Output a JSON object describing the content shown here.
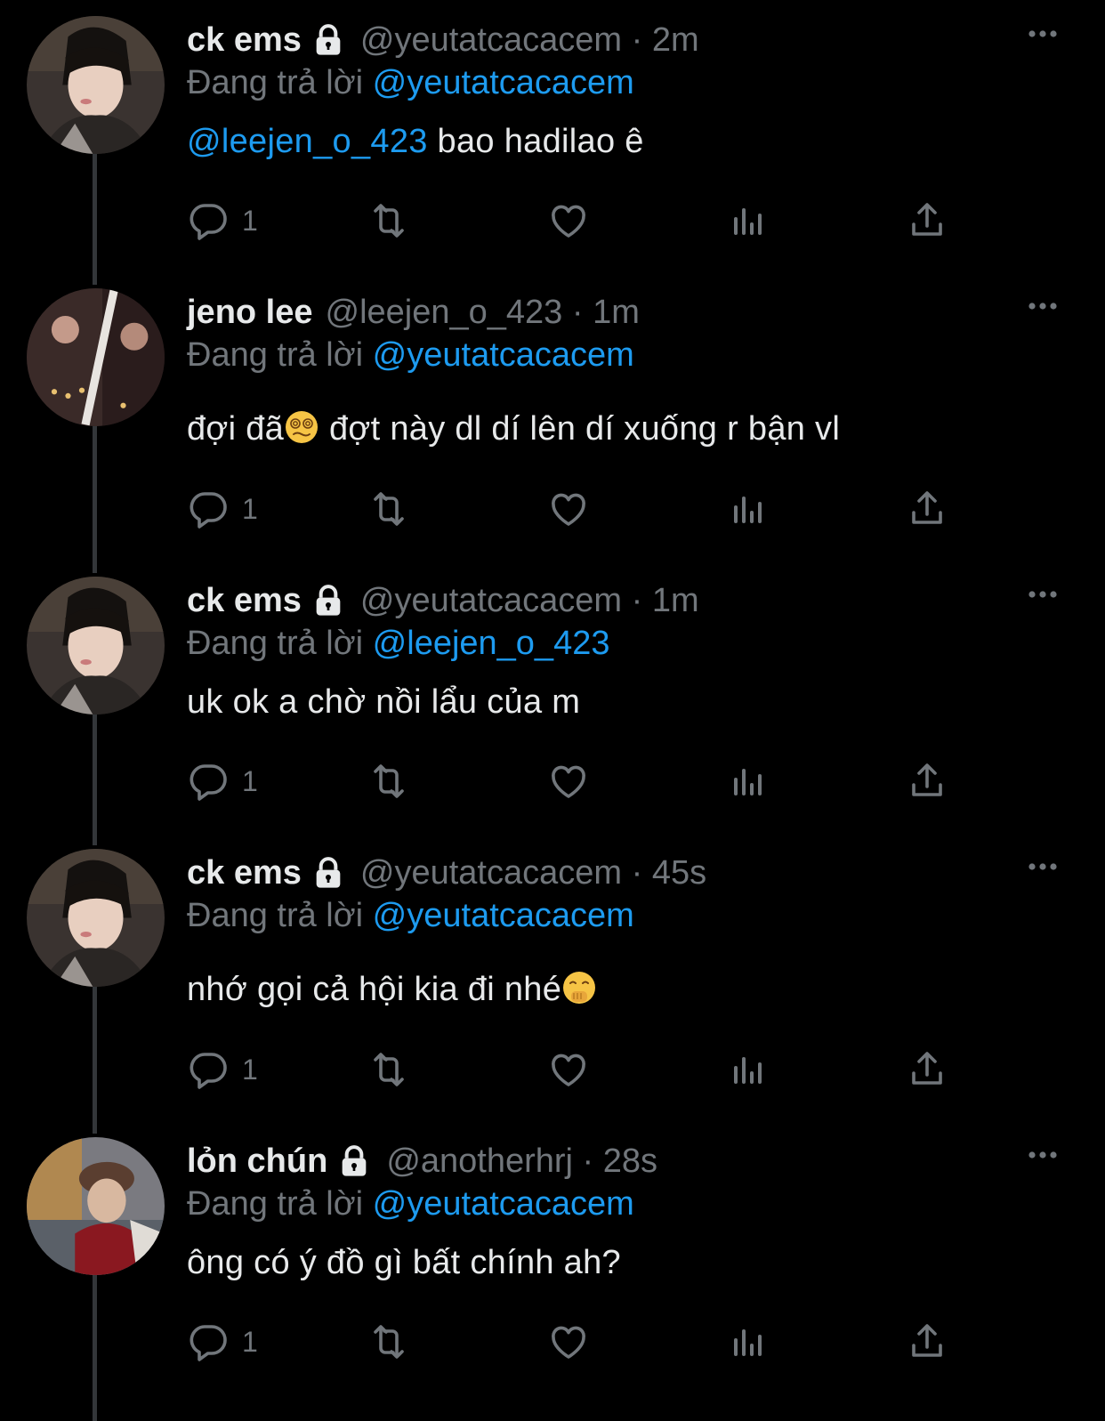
{
  "colors": {
    "background": "#000000",
    "text": "#e7e9ea",
    "secondary": "#71767b",
    "mention": "#1d9bf0",
    "thread_line": "#333639"
  },
  "icons": {
    "lock": "lock-icon",
    "more": "more-icon",
    "reply": "reply-icon",
    "retweet": "retweet-icon",
    "like": "like-icon",
    "views": "views-icon",
    "share": "share-icon"
  },
  "tweets": [
    {
      "name": "ck ems",
      "handle": "@yeutatcacacem",
      "time": "2m",
      "replying_label": "Đang trả lời",
      "replying_to": "@yeutatcacacem",
      "mention": "@leejen_o_423",
      "text": " bao hadilao ê",
      "reply_count": "1"
    },
    {
      "name": "jeno lee",
      "handle": "@leejen_o_423",
      "time": "1m",
      "replying_label": "Đang trả lời",
      "replying_to": "@yeutatcacacem",
      "text": "đợi đã",
      "text_after_emoji": " đợt này dl dí lên dí xuống r bận vl",
      "emoji": "dizzy-face-emoji",
      "reply_count": "1"
    },
    {
      "name": "ck ems",
      "handle": "@yeutatcacacem",
      "time": "1m",
      "replying_label": "Đang trả lời",
      "replying_to": "@leejen_o_423",
      "text": "uk ok a chờ nồi lẩu của m",
      "reply_count": "1"
    },
    {
      "name": "ck ems",
      "handle": "@yeutatcacacem",
      "time": "45s",
      "replying_label": "Đang trả lời",
      "replying_to": "@yeutatcacacem",
      "text": "nhớ gọi cả hội kia đi nhé",
      "emoji": "shushing-face-emoji",
      "reply_count": "1"
    },
    {
      "name": "lỏn chún",
      "handle": "@anotherhrj",
      "time": "28s",
      "replying_label": "Đang trả lời",
      "replying_to": "@yeutatcacacem",
      "text": "ông có ý đồ gì bất chính ah?",
      "reply_count": "1"
    }
  ]
}
